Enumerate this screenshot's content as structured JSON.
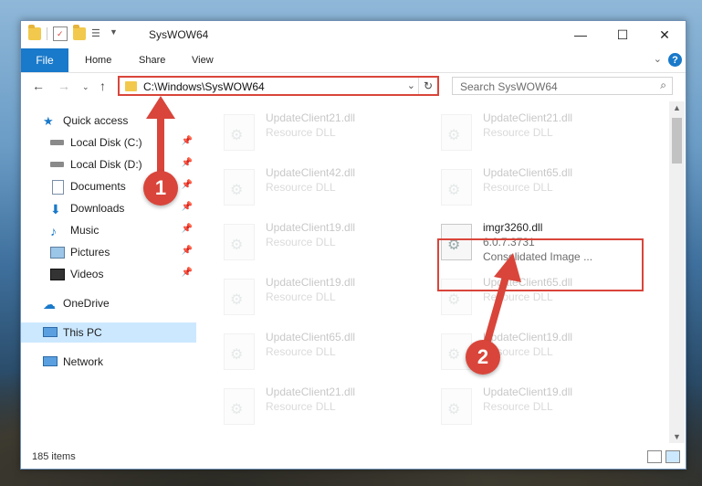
{
  "window": {
    "title": "SysWOW64"
  },
  "ribbon": {
    "file_tab": "File",
    "tabs": [
      "Home",
      "Share",
      "View"
    ],
    "help": "?"
  },
  "address_bar": {
    "path": "C:\\Windows\\SysWOW64"
  },
  "search": {
    "placeholder": "Search SysWOW64"
  },
  "nav_pane": {
    "items": [
      {
        "label": "Quick access",
        "icon": "star-icon"
      },
      {
        "label": "Local Disk (C:)",
        "icon": "drive-icon",
        "pinned": true
      },
      {
        "label": "Local Disk (D:)",
        "icon": "drive-icon",
        "pinned": true
      },
      {
        "label": "Documents",
        "icon": "documents-icon",
        "pinned": true
      },
      {
        "label": "Downloads",
        "icon": "download-icon",
        "pinned": true
      },
      {
        "label": "Music",
        "icon": "music-icon",
        "pinned": true
      },
      {
        "label": "Pictures",
        "icon": "pictures-icon",
        "pinned": true
      },
      {
        "label": "Videos",
        "icon": "videos-icon",
        "pinned": true
      },
      {
        "label": "OneDrive",
        "icon": "cloud-icon"
      },
      {
        "label": "This PC",
        "icon": "computer-icon",
        "selected": true
      },
      {
        "label": "Network",
        "icon": "network-icon"
      }
    ]
  },
  "files": [
    {
      "name": "UpdateClient21.dll",
      "sub": "Resource DLL"
    },
    {
      "name": "UpdateClient21.dll",
      "sub": "Resource DLL"
    },
    {
      "name": "UpdateClient42.dll",
      "sub": "Resource DLL"
    },
    {
      "name": "UpdateClient65.dll",
      "sub": "Resource DLL"
    },
    {
      "name": "UpdateClient19.dll",
      "sub": "Resource DLL"
    },
    {
      "name": "imgr3260.dll",
      "sub": "6.0.7.3731",
      "sub2": "Consolidated Image ..."
    },
    {
      "name": "UpdateClient19.dll",
      "sub": "Resource DLL"
    },
    {
      "name": "UpdateClient65.dll",
      "sub": "Resource DLL"
    },
    {
      "name": "UpdateClient65.dll",
      "sub": "Resource DLL"
    },
    {
      "name": "UpdateClient19.dll",
      "sub": "Resource DLL"
    },
    {
      "name": "UpdateClient21.dll",
      "sub": "Resource DLL"
    },
    {
      "name": "UpdateClient19.dll",
      "sub": "Resource DLL"
    }
  ],
  "status": {
    "count": "185 items"
  },
  "annotations": {
    "step1": "1",
    "step2": "2"
  },
  "colors": {
    "accent": "#1979ca",
    "highlight": "#d9453a",
    "selected": "#cce8ff"
  }
}
